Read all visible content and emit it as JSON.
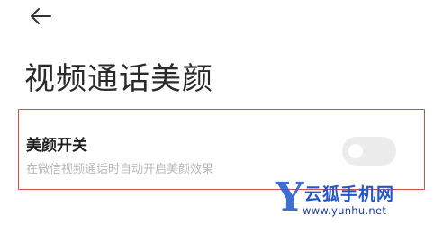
{
  "header": {
    "back_icon": "arrow-left-icon",
    "title": "视频通话美颜"
  },
  "settings": {
    "beauty_toggle": {
      "title": "美颜开关",
      "description": "在微信视频通话时自动开启美颜效果",
      "enabled": false
    }
  },
  "watermark": {
    "letter": "Y",
    "site_name": "云狐手机网",
    "url": "www.yunhu.net"
  },
  "colors": {
    "highlight_border": "#c9514e",
    "toggle_off": "#ececec",
    "watermark_blue": "#2457c8"
  }
}
